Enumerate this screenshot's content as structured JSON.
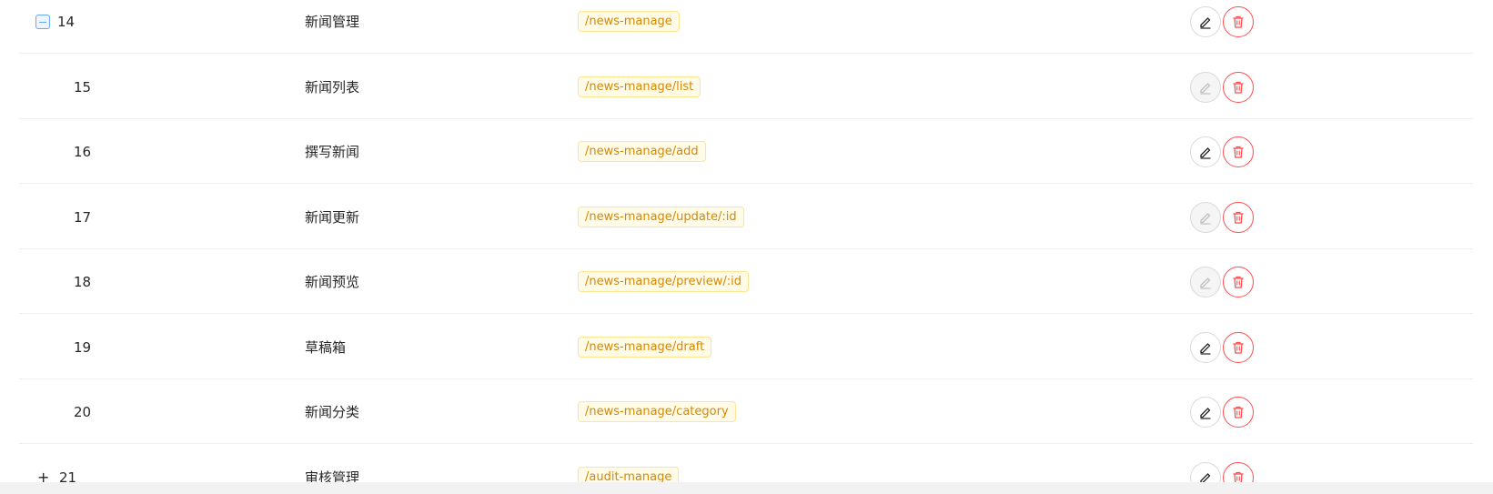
{
  "rows": [
    {
      "id": "14",
      "name": "新闻管理",
      "path": "/news-manage",
      "expand": "open",
      "edit_disabled": false
    },
    {
      "id": "15",
      "name": "新闻列表",
      "path": "/news-manage/list",
      "expand": "none",
      "edit_disabled": true
    },
    {
      "id": "16",
      "name": "撰写新闻",
      "path": "/news-manage/add",
      "expand": "none",
      "edit_disabled": false
    },
    {
      "id": "17",
      "name": "新闻更新",
      "path": "/news-manage/update/:id",
      "expand": "none",
      "edit_disabled": true
    },
    {
      "id": "18",
      "name": "新闻预览",
      "path": "/news-manage/preview/:id",
      "expand": "none",
      "edit_disabled": true
    },
    {
      "id": "19",
      "name": "草稿箱",
      "path": "/news-manage/draft",
      "expand": "none",
      "edit_disabled": false
    },
    {
      "id": "20",
      "name": "新闻分类",
      "path": "/news-manage/category",
      "expand": "none",
      "edit_disabled": false
    },
    {
      "id": "21",
      "name": "审核管理",
      "path": "/audit-manage",
      "expand": "closed",
      "edit_disabled": false
    }
  ],
  "icons": {
    "expand_open": "minus-square-icon",
    "expand_closed": "plus-icon",
    "edit": "edit-icon",
    "delete": "delete-icon"
  },
  "colors": {
    "tag_text": "#d48806",
    "tag_border": "#ffe58f",
    "tag_bg": "#fffbe6",
    "delete": "#ff4d4f",
    "expander": "#69a8f5"
  }
}
